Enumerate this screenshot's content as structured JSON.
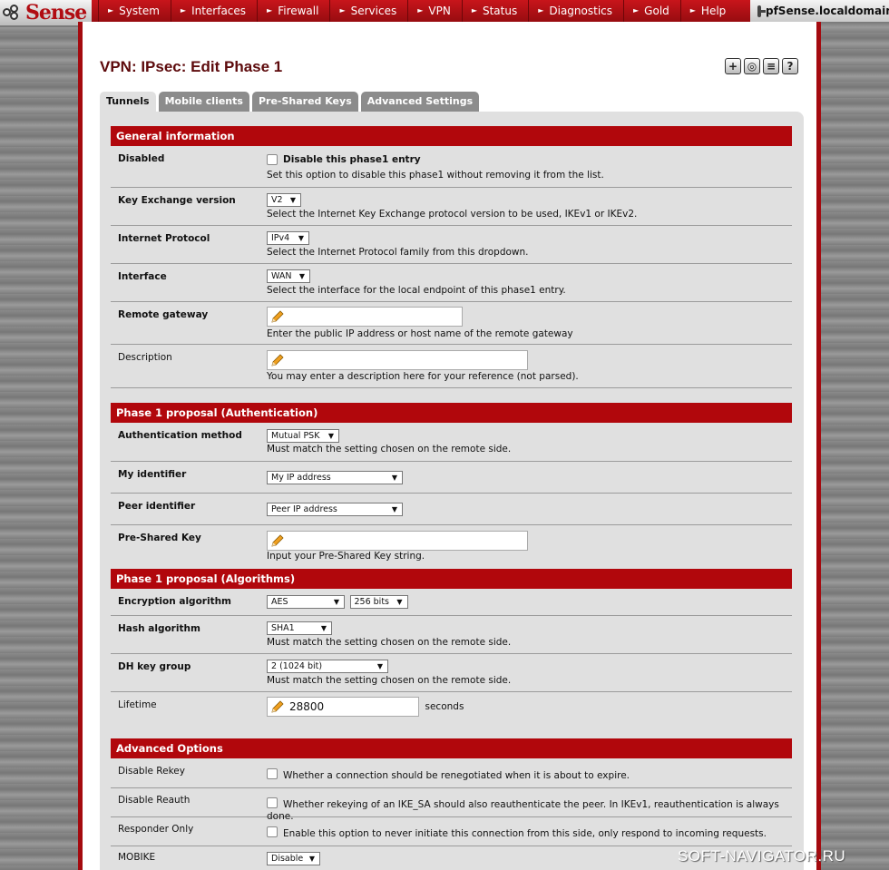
{
  "brand": {
    "logo_prefix": "pf",
    "logo_text": "Sense"
  },
  "nav": [
    "System",
    "Interfaces",
    "Firewall",
    "Services",
    "VPN",
    "Status",
    "Diagnostics",
    "Gold",
    "Help"
  ],
  "hostname": "pfSense.localdomain",
  "page_title": "VPN: IPsec: Edit Phase 1",
  "tabs": [
    {
      "label": "Tunnels",
      "active": true
    },
    {
      "label": "Mobile clients",
      "active": false
    },
    {
      "label": "Pre-Shared Keys",
      "active": false
    },
    {
      "label": "Advanced Settings",
      "active": false
    }
  ],
  "general": {
    "header": "General information",
    "disabled": {
      "label": "Disabled",
      "checkbox_label": "Disable this phase1 entry",
      "checked": false,
      "desc": "Set this option to disable this phase1 without removing it from the list."
    },
    "kex": {
      "label": "Key Exchange version",
      "value": "V2",
      "desc": "Select the Internet Key Exchange protocol version to be used, IKEv1 or IKEv2."
    },
    "protocol": {
      "label": "Internet Protocol",
      "value": "IPv4",
      "desc": "Select the Internet Protocol family from this dropdown."
    },
    "interface": {
      "label": "Interface",
      "value": "WAN",
      "desc": "Select the interface for the local endpoint of this phase1 entry."
    },
    "remote_gw": {
      "label": "Remote gateway",
      "value": "",
      "desc": "Enter the public IP address or host name of the remote gateway"
    },
    "description": {
      "label": "Description",
      "value": "",
      "desc": "You may enter a description here for your reference (not parsed)."
    }
  },
  "auth": {
    "header": "Phase 1 proposal (Authentication)",
    "method": {
      "label": "Authentication method",
      "value": "Mutual PSK",
      "desc": "Must match the setting chosen on the remote side."
    },
    "my_id": {
      "label": "My identifier",
      "value": "My IP address"
    },
    "peer_id": {
      "label": "Peer identifier",
      "value": "Peer IP address"
    },
    "psk": {
      "label": "Pre-Shared Key",
      "value": "",
      "desc": "Input your Pre-Shared Key string."
    }
  },
  "algo": {
    "header": "Phase 1 proposal (Algorithms)",
    "encryption": {
      "label": "Encryption algorithm",
      "value": "AES",
      "bits": "256 bits"
    },
    "hash": {
      "label": "Hash algorithm",
      "value": "SHA1",
      "desc": "Must match the setting chosen on the remote side."
    },
    "dh": {
      "label": "DH key group",
      "value": "2 (1024 bit)",
      "desc": "Must match the setting chosen on the remote side."
    },
    "lifetime": {
      "label": "Lifetime",
      "value": "28800",
      "unit": "seconds"
    }
  },
  "advanced": {
    "header": "Advanced Options",
    "rekey": {
      "label": "Disable Rekey",
      "checked": false,
      "desc": "Whether a connection should be renegotiated when it is about to expire."
    },
    "reauth": {
      "label": "Disable Reauth",
      "checked": false,
      "desc": "Whether rekeying of an IKE_SA should also reauthenticate the peer. In IKEv1, reauthentication is always done."
    },
    "responder": {
      "label": "Responder Only",
      "checked": false,
      "desc": "Enable this option to never initiate this connection from this side, only respond to incoming requests."
    },
    "mobike": {
      "label": "MOBIKE",
      "value": "Disable"
    }
  },
  "watermark": "SOFT-NAVIGATOR.RU",
  "colors": {
    "brand_red": "#b1070c",
    "panel": "#e0e0e0",
    "title": "#5d0a0c"
  },
  "title_icons": [
    "add-icon",
    "settings-icon",
    "list-icon",
    "help-icon"
  ]
}
